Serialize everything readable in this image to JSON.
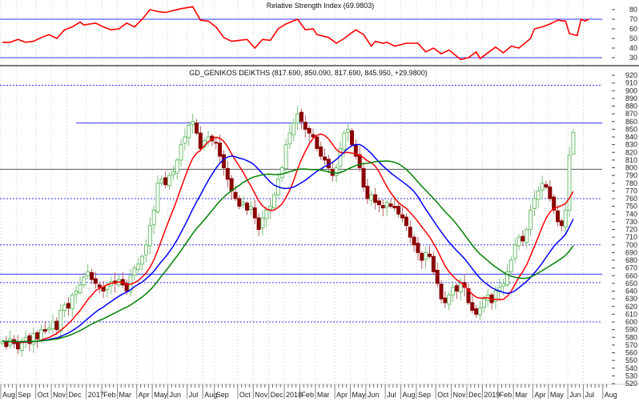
{
  "chart_data": [
    {
      "type": "line",
      "title": "Relative Strength Index (69.9803)",
      "ylim": [
        25,
        85
      ],
      "yticks": [
        80,
        70,
        60,
        50,
        40,
        30
      ],
      "reference_levels": [
        70,
        30
      ],
      "x_unit": "week index",
      "points": [
        [
          0,
          46
        ],
        [
          2,
          46
        ],
        [
          4,
          49
        ],
        [
          6,
          46
        ],
        [
          8,
          47
        ],
        [
          10,
          51
        ],
        [
          12,
          54
        ],
        [
          14,
          50
        ],
        [
          16,
          59
        ],
        [
          18,
          62
        ],
        [
          20,
          67
        ],
        [
          21,
          64
        ],
        [
          24,
          66
        ],
        [
          26,
          62
        ],
        [
          28,
          59
        ],
        [
          30,
          60
        ],
        [
          32,
          66
        ],
        [
          34,
          62
        ],
        [
          36,
          70
        ],
        [
          38,
          80
        ],
        [
          40,
          78
        ],
        [
          42,
          77
        ],
        [
          44,
          79
        ],
        [
          46,
          81
        ],
        [
          49,
          83
        ],
        [
          51,
          69
        ],
        [
          53,
          68
        ],
        [
          55,
          62
        ],
        [
          57,
          51
        ],
        [
          59,
          47
        ],
        [
          61,
          48
        ],
        [
          63,
          49
        ],
        [
          65,
          40
        ],
        [
          67,
          49
        ],
        [
          69,
          48
        ],
        [
          71,
          60
        ],
        [
          73,
          65
        ],
        [
          76,
          70
        ],
        [
          78,
          59
        ],
        [
          80,
          60
        ],
        [
          81,
          54
        ],
        [
          84,
          51
        ],
        [
          86,
          45
        ],
        [
          88,
          50
        ],
        [
          91,
          59
        ],
        [
          93,
          54
        ],
        [
          95,
          42
        ],
        [
          96,
          47
        ],
        [
          98,
          45
        ],
        [
          99,
          46
        ],
        [
          101,
          42
        ],
        [
          104,
          45
        ],
        [
          107,
          45
        ],
        [
          109,
          36
        ],
        [
          111,
          40
        ],
        [
          113,
          34
        ],
        [
          115,
          38
        ],
        [
          118,
          28
        ],
        [
          120,
          30
        ],
        [
          122,
          36
        ],
        [
          123,
          29
        ],
        [
          127,
          41
        ],
        [
          129,
          35
        ],
        [
          131,
          42
        ],
        [
          133,
          40
        ],
        [
          136,
          50
        ],
        [
          137,
          60
        ],
        [
          139,
          62
        ],
        [
          141,
          65
        ],
        [
          143,
          69
        ],
        [
          145,
          68
        ],
        [
          146,
          55
        ],
        [
          148,
          53
        ],
        [
          149,
          70
        ],
        [
          150,
          68
        ],
        [
          151,
          70
        ]
      ]
    },
    {
      "type": "candlestick",
      "title": "GD_GENIKOS DEIKTHS (817.690, 850.090, 817.690, 845.950, +29.9800)",
      "ylim": [
        520,
        920
      ],
      "ytick_step": 10,
      "x_unit": "week index",
      "xtick_labels": [
        [
          "Aug",
          0
        ],
        [
          "Sep",
          4
        ],
        [
          "Oct",
          9
        ],
        [
          "Nov",
          13
        ],
        [
          "Dec",
          17
        ],
        [
          "2017",
          22
        ],
        [
          "Feb",
          26
        ],
        [
          "Mar",
          30
        ],
        [
          "Apr",
          35
        ],
        [
          "May",
          39
        ],
        [
          "Jun",
          43
        ],
        [
          "Jul",
          48
        ],
        [
          "Aug",
          52
        ],
        [
          "Sep",
          55
        ],
        [
          "Oct",
          61
        ],
        [
          "Nov",
          65
        ],
        [
          "Dec",
          69
        ],
        [
          "2018",
          73
        ],
        [
          "Feb",
          77
        ],
        [
          "Mar",
          81
        ],
        [
          "Apr",
          86
        ],
        [
          "May",
          90
        ],
        [
          "Jun",
          94
        ],
        [
          "Jul",
          99
        ],
        [
          "Aug",
          103
        ],
        [
          "Sep",
          107
        ],
        [
          "Oct",
          112
        ],
        [
          "Nov",
          116
        ],
        [
          "Dec",
          120
        ],
        [
          "2019",
          124
        ],
        [
          "Feb",
          128
        ],
        [
          "Mar",
          132
        ],
        [
          "Apr",
          137
        ],
        [
          "May",
          141
        ],
        [
          "Jun",
          146
        ],
        [
          "Jul",
          150
        ],
        [
          "Aug",
          155
        ]
      ],
      "close": [
        575,
        568,
        578,
        572,
        565,
        575,
        580,
        572,
        585,
        578,
        590,
        588,
        592,
        600,
        590,
        615,
        622,
        618,
        635,
        640,
        648,
        658,
        665,
        655,
        650,
        645,
        640,
        648,
        652,
        650,
        655,
        648,
        640,
        660,
        670,
        675,
        685,
        700,
        725,
        745,
        780,
        785,
        778,
        790,
        795,
        810,
        830,
        840,
        855,
        860,
        845,
        825,
        835,
        840,
        835,
        832,
        815,
        800,
        785,
        770,
        760,
        750,
        755,
        745,
        750,
        735,
        720,
        735,
        745,
        750,
        765,
        785,
        800,
        830,
        845,
        858,
        870,
        860,
        850,
        845,
        840,
        825,
        815,
        810,
        800,
        790,
        800,
        825,
        845,
        850,
        830,
        815,
        800,
        775,
        760,
        765,
        755,
        752,
        748,
        755,
        750,
        748,
        740,
        735,
        725,
        710,
        700,
        690,
        680,
        690,
        685,
        665,
        650,
        630,
        625,
        635,
        645,
        640,
        650,
        645,
        625,
        615,
        610,
        618,
        630,
        635,
        625,
        640,
        645,
        650,
        665,
        680,
        700,
        710,
        705,
        720,
        745,
        760,
        770,
        780,
        775,
        760,
        745,
        730,
        725,
        745,
        816,
        845.95
      ],
      "last_candle": {
        "open": 817.69,
        "high": 850.09,
        "low": 817.69,
        "close": 845.95,
        "change": 29.98
      },
      "moving_averages": [
        {
          "period": 10,
          "color": "#ff0000"
        },
        {
          "period": 20,
          "color": "#0000ff"
        },
        {
          "period": 30,
          "color": "#008000"
        }
      ],
      "horizontal_lines": [
        {
          "value": 907,
          "style": "dotted"
        },
        {
          "value": 858,
          "style": "solid"
        },
        {
          "value": 798,
          "style": "solid-dark"
        },
        {
          "value": 760,
          "style": "dotted"
        },
        {
          "value": 700,
          "style": "dotted"
        },
        {
          "value": 662,
          "style": "solid"
        },
        {
          "value": 651,
          "style": "dotted"
        },
        {
          "value": 600,
          "style": "dotted"
        }
      ],
      "colors": {
        "up": "#90d090",
        "down": "#8b0000",
        "line": "#3333ff"
      }
    }
  ]
}
